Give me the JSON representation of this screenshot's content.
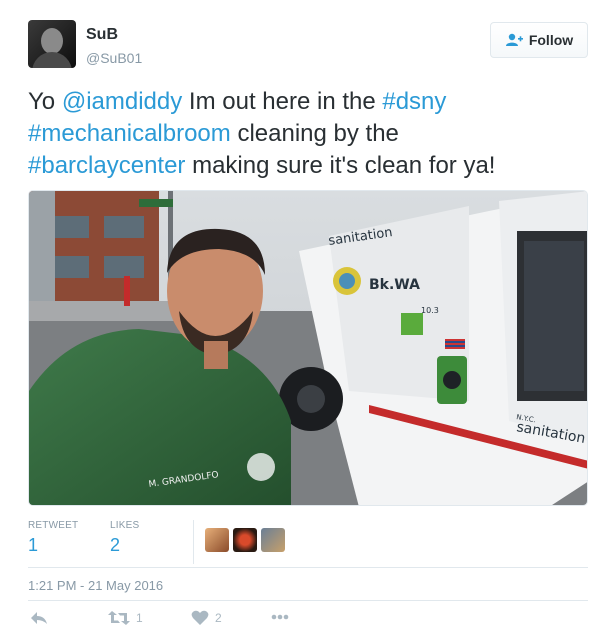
{
  "user": {
    "name": "SuB",
    "handle": "@SuB01"
  },
  "follow_button": {
    "label": "Follow",
    "icon": "add-user-icon"
  },
  "tweet": {
    "lines": [
      [
        {
          "text": "Yo ",
          "link": false
        },
        {
          "text": "@iamdiddy",
          "link": true
        },
        {
          "text": " Im out here in the ",
          "link": false
        },
        {
          "text": "#dsny",
          "link": true
        }
      ],
      [
        {
          "text": "#mechanicalbroom",
          "link": true
        },
        {
          "text": " cleaning by the",
          "link": false
        }
      ],
      [
        {
          "text": "#barclaycenter",
          "link": true
        },
        {
          "text": " making sure it's clean for ya!",
          "link": false
        }
      ]
    ]
  },
  "photo": {
    "vehicle_brand": "sanitation",
    "vehicle_code": "Bk.WA",
    "vehicle_number": "10.3",
    "door_label": "sanitation",
    "door_label_small": "N.Y.C.",
    "jacket_text": "M. GRANDOLFO"
  },
  "stats": {
    "retweet_label": "RETWEET",
    "retweet_count": "1",
    "likes_label": "LIKES",
    "likes_count": "2",
    "liker_avatars": [
      "liker-avatar-1",
      "liker-avatar-2",
      "liker-avatar-3"
    ]
  },
  "timestamp": "1:21 PM - 21 May 2016",
  "actions": {
    "reply_icon": "reply-icon",
    "retweet_icon": "retweet-icon",
    "retweet_count": "1",
    "like_icon": "heart-icon",
    "like_count": "2",
    "more_icon": "more-icon"
  },
  "colors": {
    "link": "#2b9ad6",
    "text": "#292f33",
    "muted": "#8899a6",
    "border": "#e1e8ed"
  }
}
